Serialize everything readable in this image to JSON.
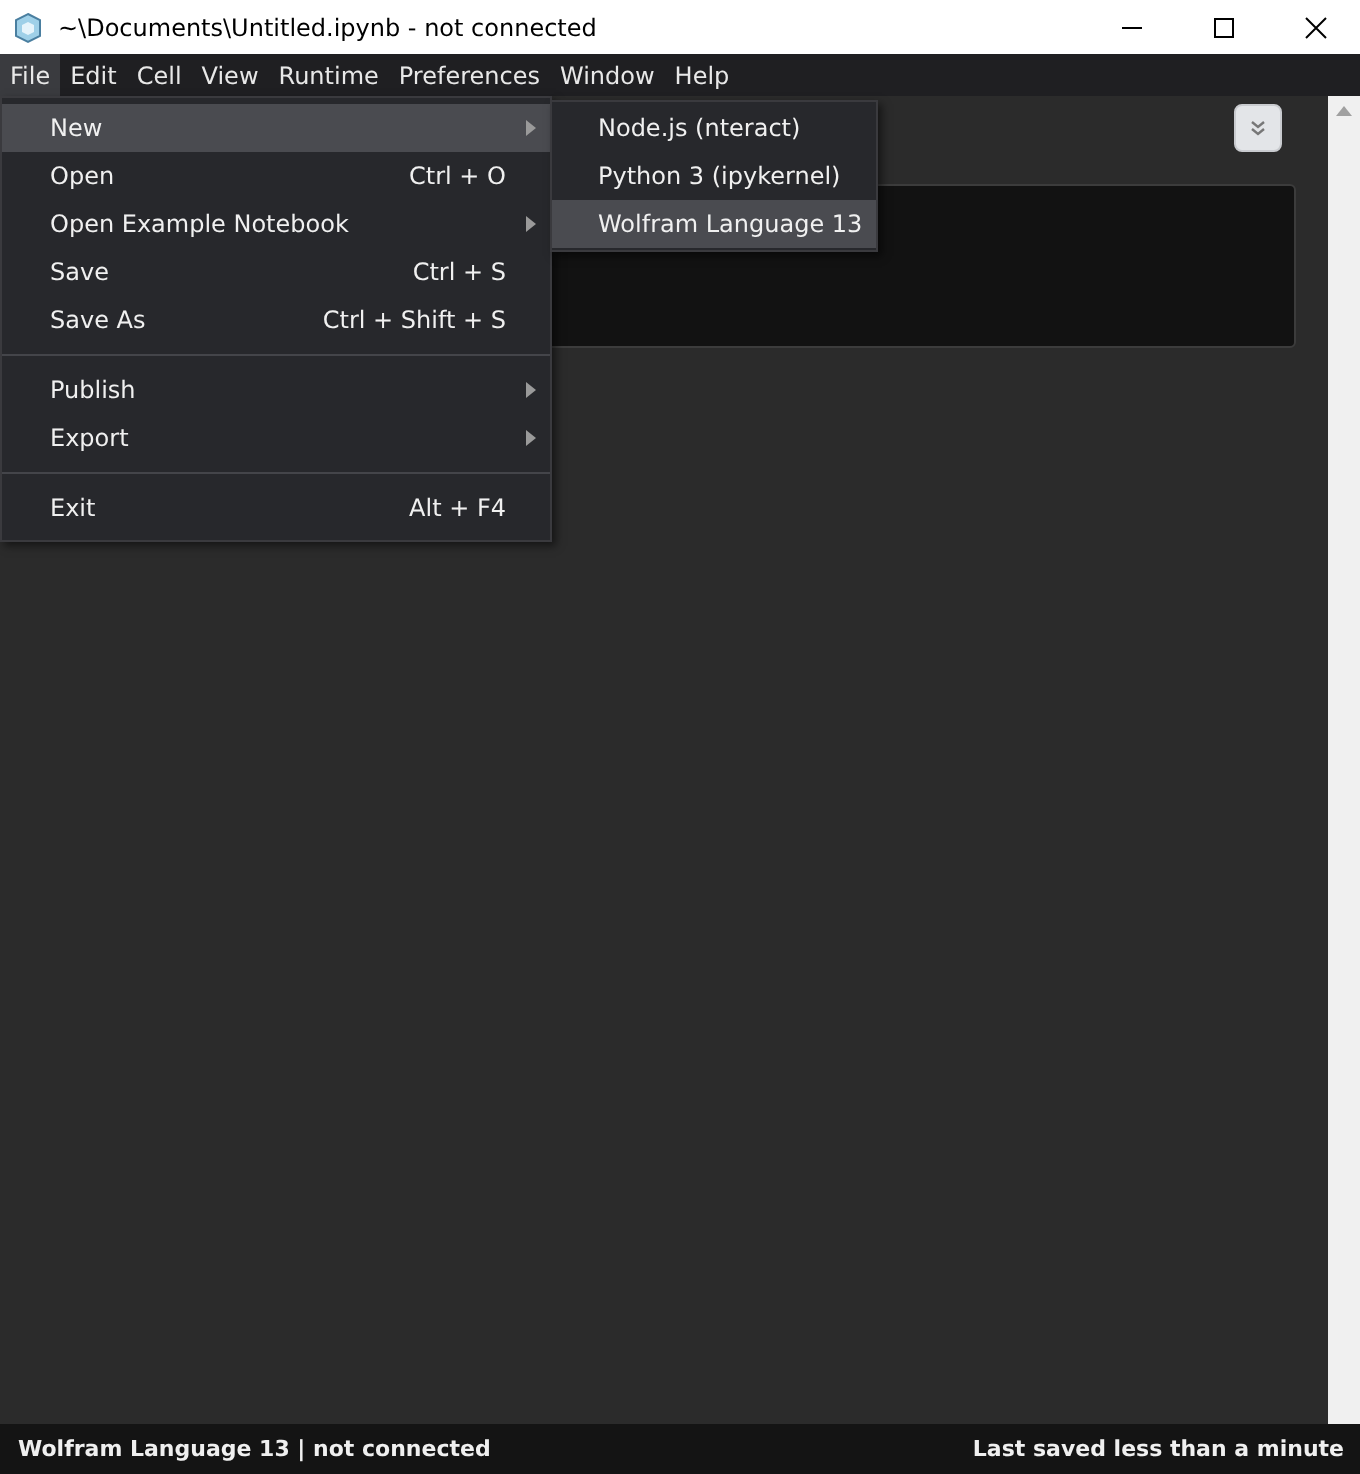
{
  "window": {
    "title": "~\\Documents\\Untitled.ipynb - not connected"
  },
  "menubar": [
    {
      "label": "File",
      "selected": true
    },
    {
      "label": "Edit",
      "selected": false
    },
    {
      "label": "Cell",
      "selected": false
    },
    {
      "label": "View",
      "selected": false
    },
    {
      "label": "Runtime",
      "selected": false
    },
    {
      "label": "Preferences",
      "selected": false
    },
    {
      "label": "Window",
      "selected": false
    },
    {
      "label": "Help",
      "selected": false
    }
  ],
  "file_menu": [
    {
      "kind": "item",
      "label": "New",
      "submenu": true,
      "selected": true
    },
    {
      "kind": "item",
      "label": "Open",
      "shortcut": "Ctrl + O",
      "submenu": false,
      "selected": false
    },
    {
      "kind": "item",
      "label": "Open Example Notebook",
      "submenu": true,
      "selected": false
    },
    {
      "kind": "item",
      "label": "Save",
      "shortcut": "Ctrl + S",
      "submenu": false,
      "selected": false
    },
    {
      "kind": "item",
      "label": "Save As",
      "shortcut": "Ctrl + Shift + S",
      "submenu": false,
      "selected": false
    },
    {
      "kind": "separator"
    },
    {
      "kind": "item",
      "label": "Publish",
      "submenu": true,
      "selected": false
    },
    {
      "kind": "item",
      "label": "Export",
      "submenu": true,
      "selected": false
    },
    {
      "kind": "separator"
    },
    {
      "kind": "item",
      "label": "Exit",
      "shortcut": "Alt + F4",
      "submenu": false,
      "selected": false
    }
  ],
  "new_submenu": [
    {
      "label": "Node.js (nteract)",
      "selected": false
    },
    {
      "label": "Python 3 (ipykernel)",
      "selected": false
    },
    {
      "label": "Wolfram Language 13",
      "selected": true
    }
  ],
  "status_bar": {
    "left": "Wolfram Language 13 | not connected",
    "right": "Last saved less than a minute"
  }
}
